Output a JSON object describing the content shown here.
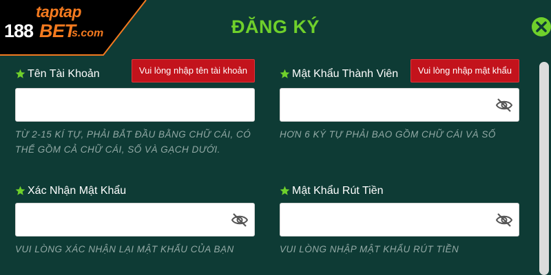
{
  "brand": {
    "logo_top": "taptap",
    "logo_number": "188",
    "logo_bet": "BET",
    "logo_domain": "s.com"
  },
  "dialog": {
    "title": "ĐĂNG KÝ",
    "close_icon": "close-icon"
  },
  "fields": [
    {
      "label": "Tên Tài Khoản",
      "error": "Vui lòng nhập tên tài khoản",
      "value": "",
      "placeholder": "",
      "hint": "TỪ 2-15 KÍ TỰ, PHẢI BẮT ĐẦU BẰNG CHỮ CÁI, CÓ THỂ GỒM CẢ CHỮ CÁI, SỐ VÀ GẠCH DƯỚI.",
      "has_eye": false
    },
    {
      "label": "Mật Khẩu Thành Viên",
      "error": "Vui lòng nhập mật khẩu",
      "value": "",
      "placeholder": "",
      "hint": "HƠN 6 KÝ TỰ PHẢI BAO GỒM CHỮ CÁI VÀ SỐ",
      "has_eye": true
    },
    {
      "label": "Xác Nhận Mật Khẩu",
      "error": "",
      "value": "",
      "placeholder": "",
      "hint": "VUI LÒNG XÁC NHẬN LẠI MẬT KHẨU CỦA BẠN",
      "has_eye": true
    },
    {
      "label": "Mật Khẩu Rút Tiền",
      "error": "",
      "value": "",
      "placeholder": "",
      "hint": "VUI LÒNG NHẬP MẬT KHẨU RÚT TIỀN",
      "has_eye": true
    }
  ],
  "colors": {
    "background": "#0e3b35",
    "accent_green": "#6fd02b",
    "error_red": "#c3131c",
    "brand_orange": "#f47a1f",
    "hint_text": "#93aaa6"
  }
}
